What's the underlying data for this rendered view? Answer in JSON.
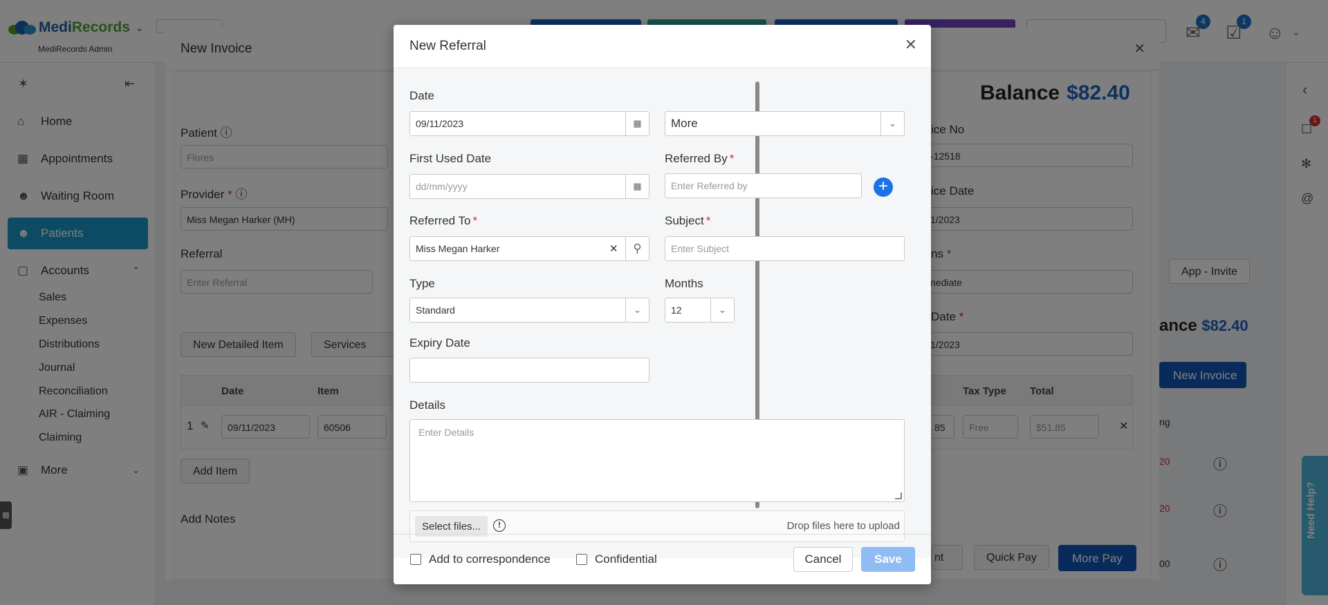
{
  "app": {
    "brand_a": "Medi",
    "brand_b": "Records",
    "subtitle": "MediRecords Admin",
    "mail_count": "4",
    "tasks_count": "1"
  },
  "sidebar": {
    "items": [
      {
        "label": "Home",
        "icon": "home-icon"
      },
      {
        "label": "Appointments",
        "icon": "calendar-icon"
      },
      {
        "label": "Waiting Room",
        "icon": "people-icon"
      },
      {
        "label": "Patients",
        "icon": "people-icon"
      },
      {
        "label": "Accounts",
        "icon": "folder-icon"
      },
      {
        "label": "More",
        "icon": "more-icon"
      }
    ],
    "accounts_sub": [
      "Sales",
      "Expenses",
      "Distributions",
      "Journal",
      "Reconciliation",
      "AIR - Claiming",
      "Claiming"
    ]
  },
  "invoice": {
    "title": "New Invoice",
    "patient_label": "Patient",
    "patient_value": "Flores",
    "provider_label": "Provider",
    "provider_value": "Miss Megan Harker (MH)",
    "referral_label": "Referral",
    "referral_placeholder": "Enter Referral",
    "balance_label": "Balance",
    "balance_value": "$82.40",
    "invoice_no_label": "ice No",
    "invoice_no_value": "-12518",
    "invoice_date_label": "ice Date",
    "invoice_date_value": "1/2023",
    "terms_label": "ns",
    "terms_value": "nediate",
    "due_date_label": "Date",
    "due_date_value": "1/2023",
    "new_detailed_item": "New Detailed Item",
    "services": "Services",
    "add_item": "Add Item",
    "add_notes": "Add Notes",
    "grid_headers": [
      "Date",
      "Item",
      "Tax Type",
      "Total"
    ],
    "row": {
      "num": "1",
      "date": "09/11/2023",
      "item": "60506",
      "qty": "85",
      "tax": "Free",
      "total": "$51.85"
    },
    "quick_pay": "Quick Pay",
    "more_pay": "More Pay",
    "pay_partial": "nt",
    "app_invite": "App - Invite",
    "balance_small": "ance",
    "balance_small_value": "$82.40",
    "new_invoice_btn": "New Invoice",
    "right_col_hdr": "ng",
    "amount_a": "20",
    "amount_b": "20",
    "amount_c": "00",
    "red_badge": "1"
  },
  "referral": {
    "title": "New Referral",
    "date_label": "Date",
    "date_value": "09/11/2023",
    "more_value": "More",
    "first_used_label": "First Used Date",
    "first_used_placeholder": "dd/mm/yyyy",
    "referred_by_label": "Referred By",
    "referred_by_placeholder": "Enter Referred by",
    "referred_to_label": "Referred To",
    "referred_to_value": "Miss Megan Harker",
    "subject_label": "Subject",
    "subject_placeholder": "Enter Subject",
    "type_label": "Type",
    "type_value": "Standard",
    "months_label": "Months",
    "months_value": "12",
    "expiry_label": "Expiry Date",
    "details_label": "Details",
    "details_placeholder": "Enter Details",
    "select_files": "Select files...",
    "drop_files": "Drop files here to upload",
    "add_correspondence": "Add to correspondence",
    "confidential": "Confidential",
    "cancel": "Cancel",
    "save": "Save"
  },
  "help": {
    "label": "Need Help?"
  }
}
